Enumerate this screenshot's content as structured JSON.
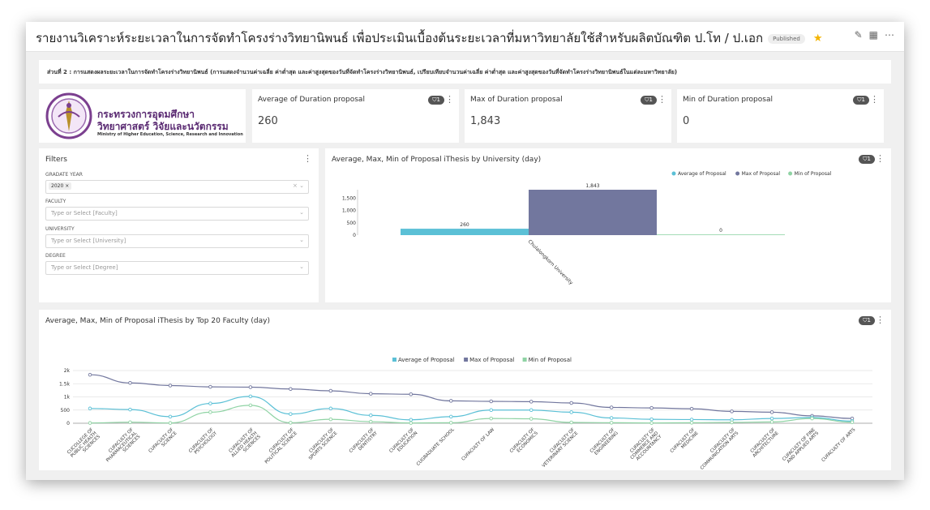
{
  "header": {
    "title": "รายงานวิเคราะห์ระยะเวลาในการจัดทำโครงร่างวิทยานิพนธ์ เพื่อประเมินเบื้องต้นระยะเวลาที่มหาวิทยาลัยใช้สำหรับผลิตบัณฑิต ป.โท / ป.เอก",
    "status_badge": "Published",
    "icons": [
      "edit-icon",
      "calendar-icon",
      "more-icon"
    ]
  },
  "section": {
    "description": "ส่วนที่ 2 : การแสดงผลระยะเวลาในการจัดทำโครงร่างวิทยานิพนธ์ (การแสดงจำนวนค่าเฉลี่ย ค่าต่ำสุด และค่าสูงสุดของวันที่จัดทำโครงร่างวิทยานิพนธ์, เปรียบเทียบจำนวนค่าเฉลี่ย ค่าต่ำสุด และค่าสูงสุดของวันที่จัดทำโครงร่างวิทยานิพนธ์ในแต่ละมหาวิทยาลัย)"
  },
  "logo": {
    "line1": "กระทรวงการอุดมศึกษา",
    "line2": "วิทยาศาสตร์ วิจัยและนวัตกรรม",
    "line3": "Ministry of Higher Education, Science, Research and Innovation"
  },
  "kpis": [
    {
      "title": "Average of Duration proposal",
      "value": "260",
      "filter_count": "1"
    },
    {
      "title": "Max of Duration proposal",
      "value": "1,843",
      "filter_count": "1"
    },
    {
      "title": "Min of Duration proposal",
      "value": "0",
      "filter_count": "1"
    }
  ],
  "filters": {
    "title": "Filters",
    "grade_year_label": "GRADATE YEAR",
    "grade_year_value": "2020",
    "faculty_label": "FACULTY",
    "faculty_placeholder": "Type or Select [Faculty]",
    "university_label": "UNIVERSITY",
    "university_placeholder": "Type or Select [University]",
    "degree_label": "DEGREE",
    "degree_placeholder": "Type or Select [Degree]"
  },
  "colors": {
    "avg": "#5bc0d6",
    "max": "#72779e",
    "min": "#8fd3a4"
  },
  "chart_data": [
    {
      "type": "bar",
      "title": "Average, Max, Min of Proposal iThesis by University (day)",
      "filter_count": "1",
      "categories": [
        "Chulalongkorn University"
      ],
      "series": [
        {
          "name": "Average of Proposal",
          "values": [
            260
          ]
        },
        {
          "name": "Max of Proposal",
          "values": [
            1843
          ]
        },
        {
          "name": "Min of Proposal",
          "values": [
            0
          ]
        }
      ],
      "value_labels": [
        "260",
        "1,843",
        "0"
      ],
      "yticks": [
        "1,500",
        "1,000",
        "500",
        "0"
      ],
      "ylim": [
        0,
        1843
      ],
      "legend": "top-right"
    },
    {
      "type": "line",
      "title": "Average, Max, Min of Proposal iThesis by Top 20 Faculty (day)",
      "filter_count": "1",
      "categories": [
        "CUFACULTY OF ALLIED HEALTH SCIENCES x",
        "CUFACULTY OF PHARMACEUTICAL SCIENCES",
        "CUFACULTY OF SCIENCE",
        "CUFACULTY OF PSYCHOLOGY",
        "CUFACULTY OF ALLIED HEALTH SCIENCES",
        "CUFACULTY OF POLITICAL SCIENCE",
        "CUFACULTY OF SPORTS SCIENCE",
        "CUFACULTY OF DENTISTRY",
        "CUFACULTY OF EDUCATION",
        "CUGRADUATE SCHOOL",
        "CUFACULTY OF LAW",
        "CUFACULTY OF ECONOMICS",
        "CUFACULTY OF VETERINARY SCIENCE",
        "CUFACULTY OF ENGINEERING",
        "CUFACULTY OF COMMERCE AND ACCOUNTANCY",
        "CUFACULTY OF MEDICINE",
        "CUFACULTY OF COMMUNICATION ARTS",
        "CUFACULTY OF ARCHITECTURE",
        "CUFACULTY OF FINE AND APPLIED ARTS",
        "CUFACULTY OF ARTS"
      ],
      "category_labels": [
        "CUCOLLEGE OF PUBLIC HEALTH SCIENCES",
        "CUFACULTY OF PHARMACEUTICAL SCIENCES",
        "CUFACULTY OF SCIENCE",
        "CUFACULTY OF PSYCHOLOGY",
        "CUFACULTY OF ALLIED HEALTH SCIENCES",
        "CUFACULTY OF POLITICAL SCIENCE",
        "CUFACULTY OF SPORTS SCIENCE",
        "CUFACULTY OF DENTISTRY",
        "CUFACULTY OF EDUCATION",
        "CUGRADUATE SCHOOL",
        "CUFACULTY OF LAW",
        "CUFACULTY OF ECONOMICS",
        "CUFACULTY OF VETERINARY SCIENCE",
        "CUFACULTY OF ENGINEERING",
        "CUFACULTY OF COMMERCE AND ACCOUNTANCY",
        "CUFACULTY OF MEDICINE",
        "CUFACULTY OF COMMUNICATION ARTS",
        "CUFACULTY OF ARCHITECTURE",
        "CUFACULTY OF FINE AND APPLIED ARTS",
        "CUFACULTY OF ARTS"
      ],
      "series": [
        {
          "name": "Average of Proposal",
          "values": [
            560,
            520,
            250,
            750,
            1020,
            350,
            560,
            300,
            130,
            250,
            500,
            500,
            420,
            200,
            150,
            140,
            130,
            180,
            220,
            80
          ]
        },
        {
          "name": "Max of Proposal",
          "values": [
            1840,
            1530,
            1430,
            1380,
            1370,
            1300,
            1230,
            1120,
            1100,
            850,
            830,
            820,
            770,
            600,
            580,
            550,
            450,
            420,
            280,
            180
          ]
        },
        {
          "name": "Min of Proposal",
          "values": [
            10,
            40,
            10,
            420,
            680,
            20,
            150,
            60,
            10,
            20,
            180,
            170,
            30,
            20,
            10,
            20,
            30,
            50,
            180,
            40
          ]
        }
      ],
      "yticks": [
        "2k",
        "1.5k",
        "1k",
        "500",
        "0"
      ],
      "ylim": [
        0,
        2000
      ],
      "legend": "top-center"
    }
  ]
}
